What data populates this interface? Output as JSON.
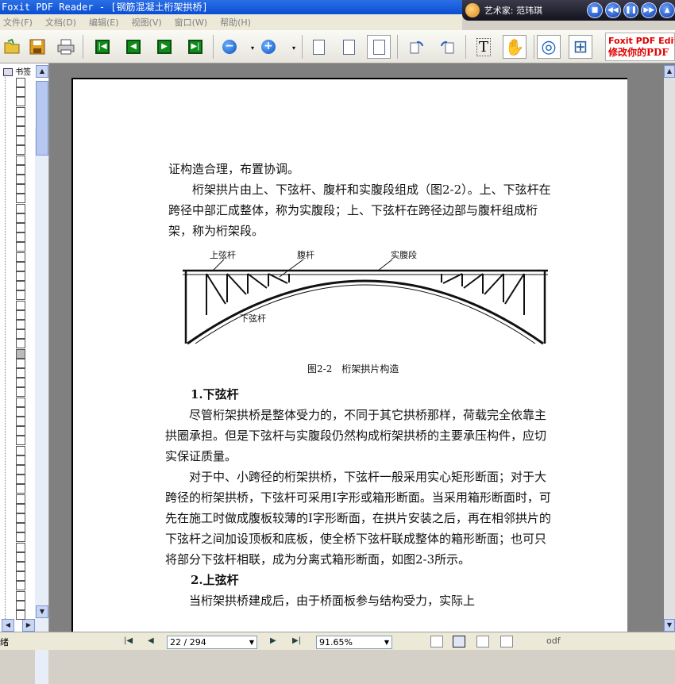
{
  "window": {
    "title": "Foxit PDF Reader - [钢筋混凝土桁架拱桥]"
  },
  "player": {
    "track": "艺术家: 范玮琪",
    "buttons": [
      "■",
      "◀◀",
      "❚❚",
      "▶▶",
      "▲"
    ]
  },
  "menu": {
    "items": [
      "文件(F)",
      "文档(D)",
      "编辑(E)",
      "视图(V)",
      "窗口(W)",
      "帮助(H)"
    ]
  },
  "toolbar": {
    "first": "|◀",
    "prev": "◀",
    "next": "▶",
    "last": "▶|",
    "zoom_out": "−",
    "zoom_in": "+",
    "dropdown": "▾",
    "select_text": "T",
    "hand": "✋",
    "globe": "◎",
    "fit": "⊞"
  },
  "ad": {
    "line1": "Foxit PDF Editor",
    "line2": "修改你的PDF"
  },
  "bookmarks": {
    "header": "书签"
  },
  "document": {
    "para1": "证构造合理，布置协调。",
    "para2": "桁架拱片由上、下弦杆、腹杆和实腹段组成（图2-2）。上、下弦杆在跨径中部汇成整体，称为实腹段；上、下弦杆在跨径边部与腹杆组成桁架，称为桁架段。",
    "figure": {
      "label_top_chord": "上弦杆",
      "label_web": "腹杆",
      "label_solid": "实腹段",
      "label_bottom_chord": "下弦杆",
      "caption": "图2-2　桁架拱片构造"
    },
    "heading1": "1.下弦杆",
    "para3": "尽管桁架拱桥是整体受力的，不同于其它拱桥那样，荷载完全依靠主拱圈承担。但是下弦杆与实腹段仍然构成桁架拱桥的主要承压构件，应切实保证质量。",
    "para4": "对于中、小跨径的桁架拱桥，下弦杆一般采用实心矩形断面；对于大跨径的桁架拱桥，下弦杆可采用I字形或箱形断面。当采用箱形断面时，可先在施工时做成腹板较薄的I字形断面，在拱片安装之后，再在相邻拱片的下弦杆之间加设顶板和底板，使全桥下弦杆联成整体的箱形断面；也可只将部分下弦杆相联，成为分离式箱形断面，如图2-3所示。",
    "heading2": "2.上弦杆",
    "para5": "当桁架拱桥建成后，由于桥面板参与结构受力，实际上"
  },
  "status": {
    "left": "绪",
    "page_display": "22 / 294",
    "zoom": "91.65%",
    "right": "odf"
  }
}
